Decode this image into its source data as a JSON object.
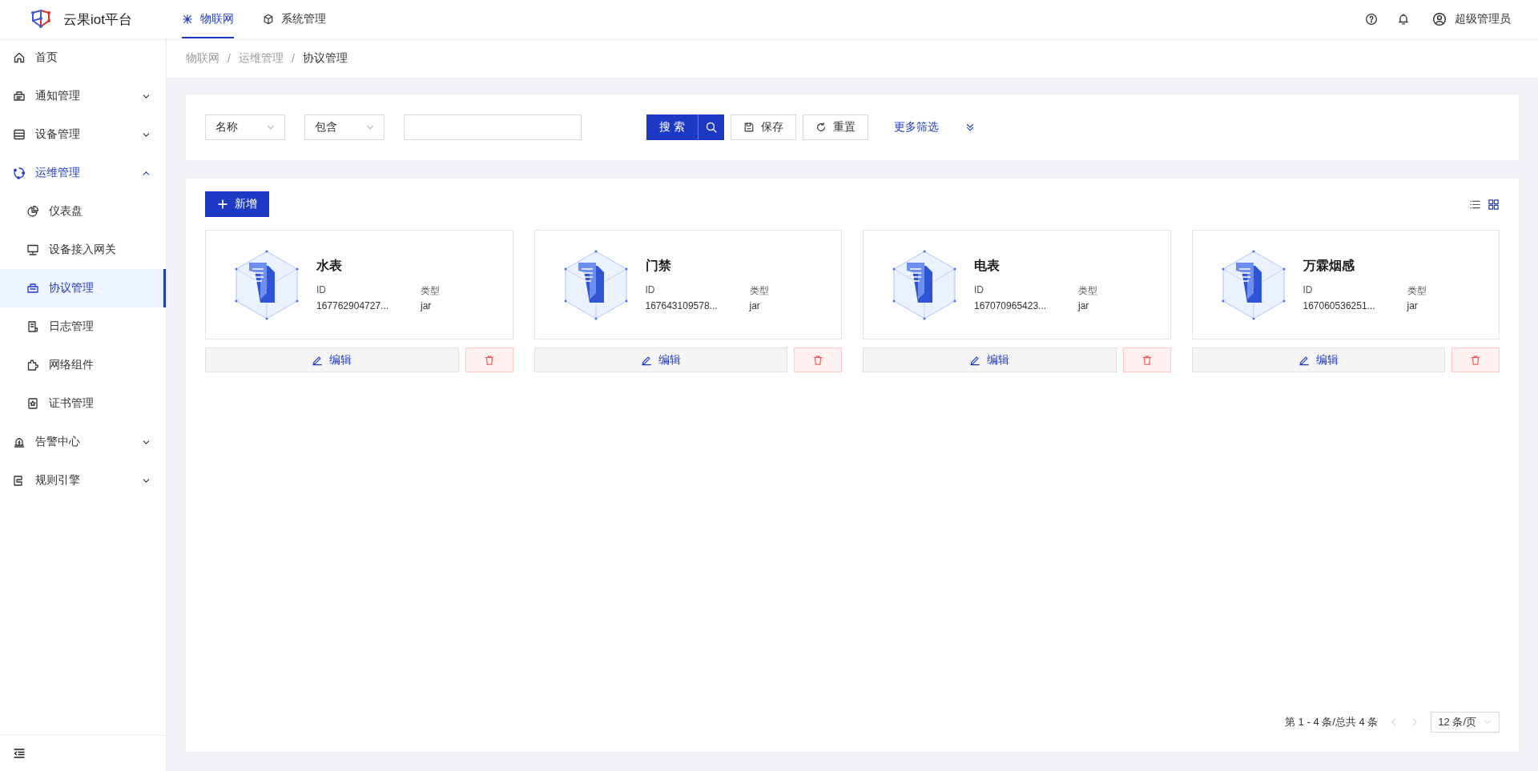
{
  "header": {
    "logo_text": "云果iot平台",
    "tabs": [
      {
        "label": "物联网",
        "selected": true
      },
      {
        "label": "系统管理",
        "selected": false
      }
    ],
    "user": "超级管理员"
  },
  "sidebar": {
    "items": [
      {
        "label": "首页",
        "selected": false
      },
      {
        "label": "通知管理",
        "selected": false,
        "expanded": false
      },
      {
        "label": "设备管理",
        "selected": false,
        "expanded": false
      },
      {
        "label": "运维管理",
        "selected": false,
        "expanded": true,
        "children": [
          {
            "label": "仪表盘",
            "selected": false
          },
          {
            "label": "设备接入网关",
            "selected": false
          },
          {
            "label": "协议管理",
            "selected": true
          },
          {
            "label": "日志管理",
            "selected": false
          },
          {
            "label": "网络组件",
            "selected": false
          },
          {
            "label": "证书管理",
            "selected": false
          }
        ]
      },
      {
        "label": "告警中心",
        "selected": false,
        "expanded": false
      },
      {
        "label": "规则引擎",
        "selected": false,
        "expanded": false
      }
    ]
  },
  "breadcrumb": {
    "items": [
      "物联网",
      "运维管理",
      "协议管理"
    ],
    "separators": [
      "/",
      "/"
    ]
  },
  "filter": {
    "field": "名称",
    "operator": "包含",
    "search_button": "搜 索",
    "save_button": "保存",
    "reset_button": "重置",
    "more_link": "更多筛选"
  },
  "toolbar": {
    "add_button": "新增",
    "views": [
      {
        "kind": "list",
        "selected": false
      },
      {
        "kind": "grid",
        "selected": true
      }
    ]
  },
  "cards": [
    {
      "name": "水表",
      "id_label": "ID",
      "id": "167762904727...",
      "type_label": "类型",
      "type": "jar",
      "edit_button": "编辑"
    },
    {
      "name": "门禁",
      "id_label": "ID",
      "id": "167643109578...",
      "type_label": "类型",
      "type": "jar",
      "edit_button": "编辑"
    },
    {
      "name": "电表",
      "id_label": "ID",
      "id": "167070965423...",
      "type_label": "类型",
      "type": "jar",
      "edit_button": "编辑"
    },
    {
      "name": "万霖烟感",
      "id_label": "ID",
      "id": "167060536251...",
      "type_label": "类型",
      "type": "jar",
      "edit_button": "编辑"
    }
  ],
  "pagination": {
    "summary": "第 1 - 4 条/总共 4 条",
    "prev_disabled": true,
    "next_disabled": true,
    "page_size": "12 条/页"
  }
}
